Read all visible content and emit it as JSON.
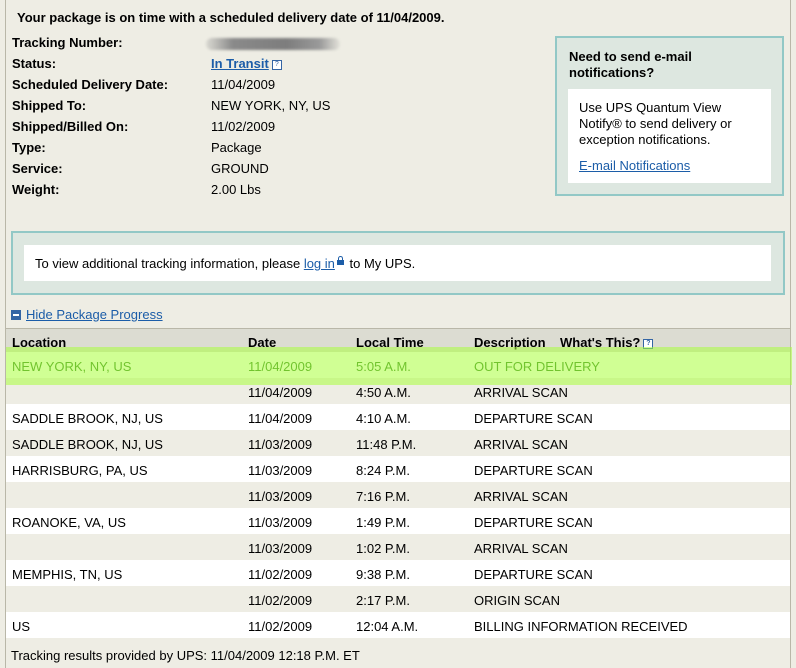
{
  "headline": "Your package is on time with a scheduled delivery date of 11/04/2009.",
  "info": [
    {
      "label": "Tracking Number:",
      "value": ""
    },
    {
      "label": "Status:",
      "value": "In Transit"
    },
    {
      "label": "Scheduled Delivery Date:",
      "value": "11/04/2009"
    },
    {
      "label": "Shipped To:",
      "value": "NEW YORK, NY, US"
    },
    {
      "label": "Shipped/Billed On:",
      "value": "11/02/2009"
    },
    {
      "label": "Type:",
      "value": "Package"
    },
    {
      "label": "Service:",
      "value": "GROUND"
    },
    {
      "label": "Weight:",
      "value": "2.00 Lbs"
    }
  ],
  "notify": {
    "title": "Need to send e-mail notifications?",
    "text": "Use UPS Quantum View Notify® to send delivery or exception notifications.",
    "link": "E-mail Notifications"
  },
  "login": {
    "before": "To view additional tracking information, please ",
    "link": "log in",
    "after": " to My UPS."
  },
  "hide_progress": "Hide Package Progress",
  "table": {
    "headers": {
      "location": "Location",
      "date": "Date",
      "time": "Local Time",
      "description": "Description",
      "whats_this": "What's This?"
    },
    "rows": [
      {
        "location": "NEW YORK, NY, US",
        "date": "11/04/2009",
        "time": "5:05 A.M.",
        "description": "OUT FOR DELIVERY"
      },
      {
        "location": "",
        "date": "11/04/2009",
        "time": "4:50 A.M.",
        "description": "ARRIVAL SCAN"
      },
      {
        "location": "SADDLE BROOK, NJ, US",
        "date": "11/04/2009",
        "time": "4:10 A.M.",
        "description": "DEPARTURE SCAN"
      },
      {
        "location": "SADDLE BROOK, NJ, US",
        "date": "11/03/2009",
        "time": "11:48 P.M.",
        "description": "ARRIVAL SCAN"
      },
      {
        "location": "HARRISBURG, PA, US",
        "date": "11/03/2009",
        "time": "8:24 P.M.",
        "description": "DEPARTURE SCAN"
      },
      {
        "location": "",
        "date": "11/03/2009",
        "time": "7:16 P.M.",
        "description": "ARRIVAL SCAN"
      },
      {
        "location": "ROANOKE, VA, US",
        "date": "11/03/2009",
        "time": "1:49 P.M.",
        "description": "DEPARTURE SCAN"
      },
      {
        "location": "",
        "date": "11/03/2009",
        "time": "1:02 P.M.",
        "description": "ARRIVAL SCAN"
      },
      {
        "location": "MEMPHIS, TN, US",
        "date": "11/02/2009",
        "time": "9:38 P.M.",
        "description": "DEPARTURE SCAN"
      },
      {
        "location": "",
        "date": "11/02/2009",
        "time": "2:17 P.M.",
        "description": "ORIGIN SCAN"
      },
      {
        "location": "US",
        "date": "11/02/2009",
        "time": "12:04 A.M.",
        "description": "BILLING INFORMATION RECEIVED"
      }
    ]
  },
  "footer": "Tracking results provided by UPS:  11/04/2009 12:18 P.M.  ET",
  "colors": {
    "link": "#1c5da8",
    "highlight": "#aaff3c",
    "box_border": "#92c8c6",
    "box_bg": "#dde7e0",
    "page_bg": "#eeede4",
    "first_row_text": "#2e7d1e"
  }
}
